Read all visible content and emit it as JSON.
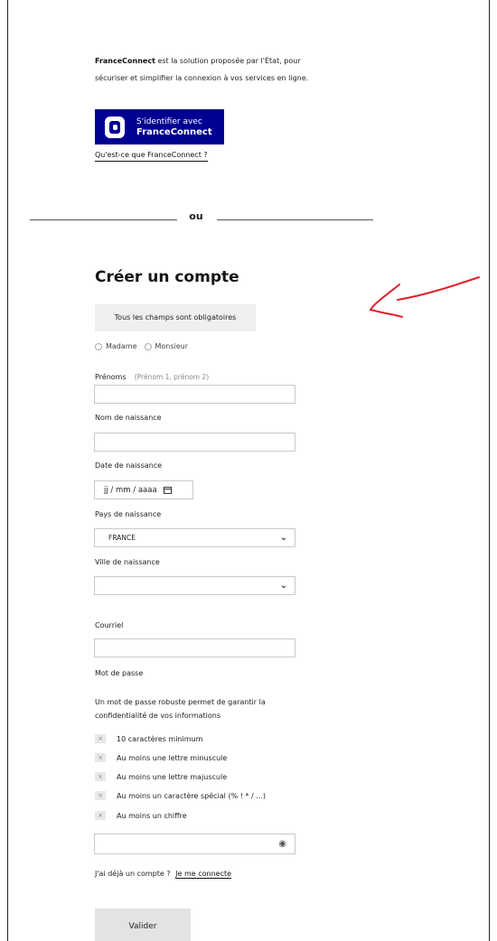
{
  "franceconnect": {
    "intro_bold": "FranceConnect",
    "intro_text": " est la solution proposée par l'État, pour sécuriser et simplifier la connexion à vos services en ligne.",
    "button_line1": "S'identifier avec",
    "button_line2": "FranceConnect",
    "info_link": "Qu'est-ce que FranceConnect ?"
  },
  "separator": {
    "text": "ou"
  },
  "form": {
    "title": "Créer un compte",
    "required_note": "Tous les champs sont obligatoires",
    "civility": [
      "Madame",
      "Monsieur"
    ],
    "firstname_label": "Prénoms",
    "firstname_hint": "(Prénom 1, prénom 2)",
    "birthname_label": "Nom de naissance",
    "birthdate_label": "Date de naissance",
    "birthdate_placeholder": "jj / mm / aaaa",
    "birthcountry_label": "Pays de naissance",
    "birthcountry_value": "FRANCE",
    "birthcity_label": "Ville de naissance",
    "birthcity_value": "",
    "email_label": "Courriel",
    "password_label": "Mot de passe",
    "password_info": "Un mot de passe robuste permet de garantir la confidentialité de vos informations",
    "criteria": [
      "10 caractères minimum",
      "Au moins une lettre minuscule",
      "Au moins une lettre majuscule",
      "Au moins un caractère spécial (% ! * / ...)",
      "Au moins un chiffre"
    ],
    "criteria_mark": "×",
    "account_question": "J'ai déjà un compte ?",
    "login_link": "Je me connecte",
    "submit_label": "Valider"
  },
  "icons": {
    "chevron": "⌄",
    "eye": "◉"
  },
  "colors": {
    "franceconnect_blue": "#000091",
    "annotation_red": "#e0202a"
  }
}
